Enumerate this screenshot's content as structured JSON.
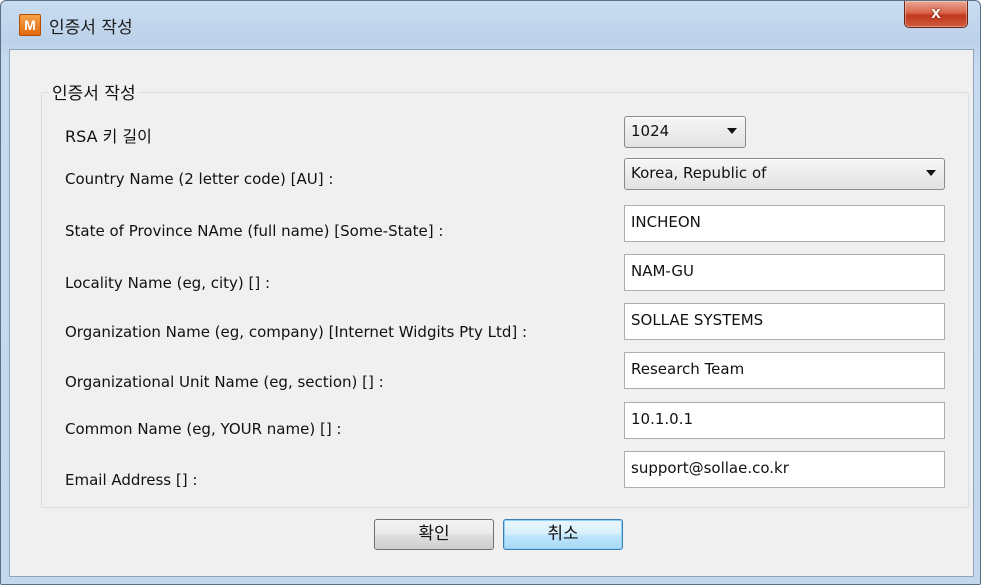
{
  "window": {
    "title": "인증서 작성",
    "app_icon_letter": "M",
    "close_label": "x"
  },
  "group": {
    "title": "인증서 작성"
  },
  "fields": {
    "rsa": {
      "label": "RSA 키 길이",
      "value": "1024"
    },
    "country": {
      "label": "Country Name (2 letter code) [AU] :",
      "value": "Korea, Republic of"
    },
    "state": {
      "label": "State of Province NAme (full name) [Some-State] :",
      "value": "INCHEON"
    },
    "locality": {
      "label": "Locality Name (eg, city) [] :",
      "value": "NAM-GU"
    },
    "organization": {
      "label": "Organization Name (eg, company) [Internet Widgits Pty Ltd] :",
      "value": "SOLLAE SYSTEMS"
    },
    "org_unit": {
      "label": "Organizational Unit Name (eg, section) [] :",
      "value": "Research Team"
    },
    "common_name": {
      "label": "Common Name (eg, YOUR name) [] :",
      "value": "10.1.0.1"
    },
    "email": {
      "label": "Email Address [] :",
      "value": "support@sollae.co.kr"
    }
  },
  "buttons": {
    "ok": "확인",
    "cancel": "취소"
  },
  "icons": {
    "app": "app-logo-icon",
    "close": "close-icon",
    "dropdown": "chevron-down-icon"
  }
}
